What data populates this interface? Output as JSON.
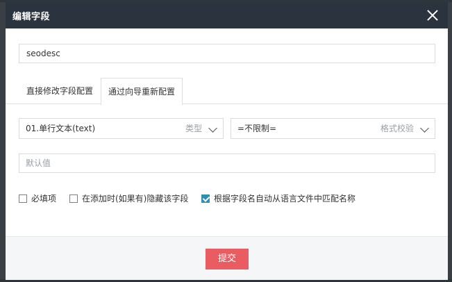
{
  "dialog": {
    "title": "编辑字段",
    "close_icon": "close-icon"
  },
  "field_name": {
    "value": "seodesc"
  },
  "tabs": [
    {
      "label": "直接修改字段配置",
      "active": false
    },
    {
      "label": "通过向导重新配置",
      "active": true
    }
  ],
  "type_select": {
    "value": "01.单行文本(text)",
    "hint": "类型",
    "icon": "chevron-down-icon"
  },
  "validation_select": {
    "value": "=不限制=",
    "hint": "格式校验",
    "icon": "chevron-down-icon"
  },
  "default_value": {
    "placeholder": "默认值"
  },
  "options": [
    {
      "label": "必填项",
      "checked": false
    },
    {
      "label": "在添加时(如果有)隐藏该字段",
      "checked": false
    },
    {
      "label": "根据字段名自动从语言文件中匹配名称",
      "checked": true
    }
  ],
  "footer": {
    "submit_label": "提交"
  },
  "colors": {
    "header_bg": "#2b333e",
    "submit_bg": "#e95c61",
    "checkbox_checked": "#2f8eb4"
  }
}
